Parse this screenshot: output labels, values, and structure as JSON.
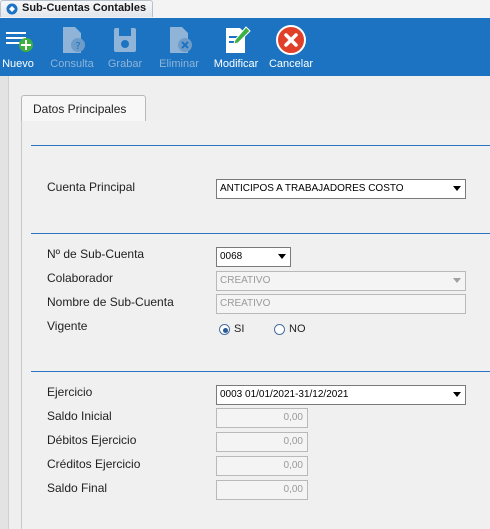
{
  "window": {
    "title": "Sub-Cuentas Contables"
  },
  "toolbar": {
    "nuevo": "Nuevo",
    "consulta": "Consulta",
    "grabar": "Grabar",
    "eliminar": "Eliminar",
    "modificar": "Modificar",
    "cancelar": "Cancelar"
  },
  "form": {
    "tab": "Datos Principales",
    "cuenta_principal": {
      "label": "Cuenta Principal",
      "value": "ANTICIPOS A TRABAJADORES COSTO"
    },
    "sub_cuenta": {
      "label": "Nº de Sub-Cuenta",
      "value": "0068"
    },
    "colaborador": {
      "label": "Colaborador",
      "value": "CREATIVO"
    },
    "nombre": {
      "label": "Nombre de Sub-Cuenta",
      "value": "CREATIVO"
    },
    "vigente": {
      "label": "Vigente",
      "options": [
        "SI",
        "NO"
      ],
      "selected": "SI"
    },
    "ejercicio": {
      "label": "Ejercicio",
      "value": "0003 01/01/2021-31/12/2021"
    },
    "saldo_inicial": {
      "label": "Saldo Inicial",
      "value": "0,00"
    },
    "debitos": {
      "label": "Débitos Ejercicio",
      "value": "0,00"
    },
    "creditos": {
      "label": "Créditos Ejercicio",
      "value": "0,00"
    },
    "saldo_final": {
      "label": "Saldo Final",
      "value": "0,00"
    }
  },
  "colors": {
    "toolbar": "#1b73c2",
    "separator": "#2b74c4",
    "cancel": "#e0402a",
    "add": "#3cb043"
  }
}
